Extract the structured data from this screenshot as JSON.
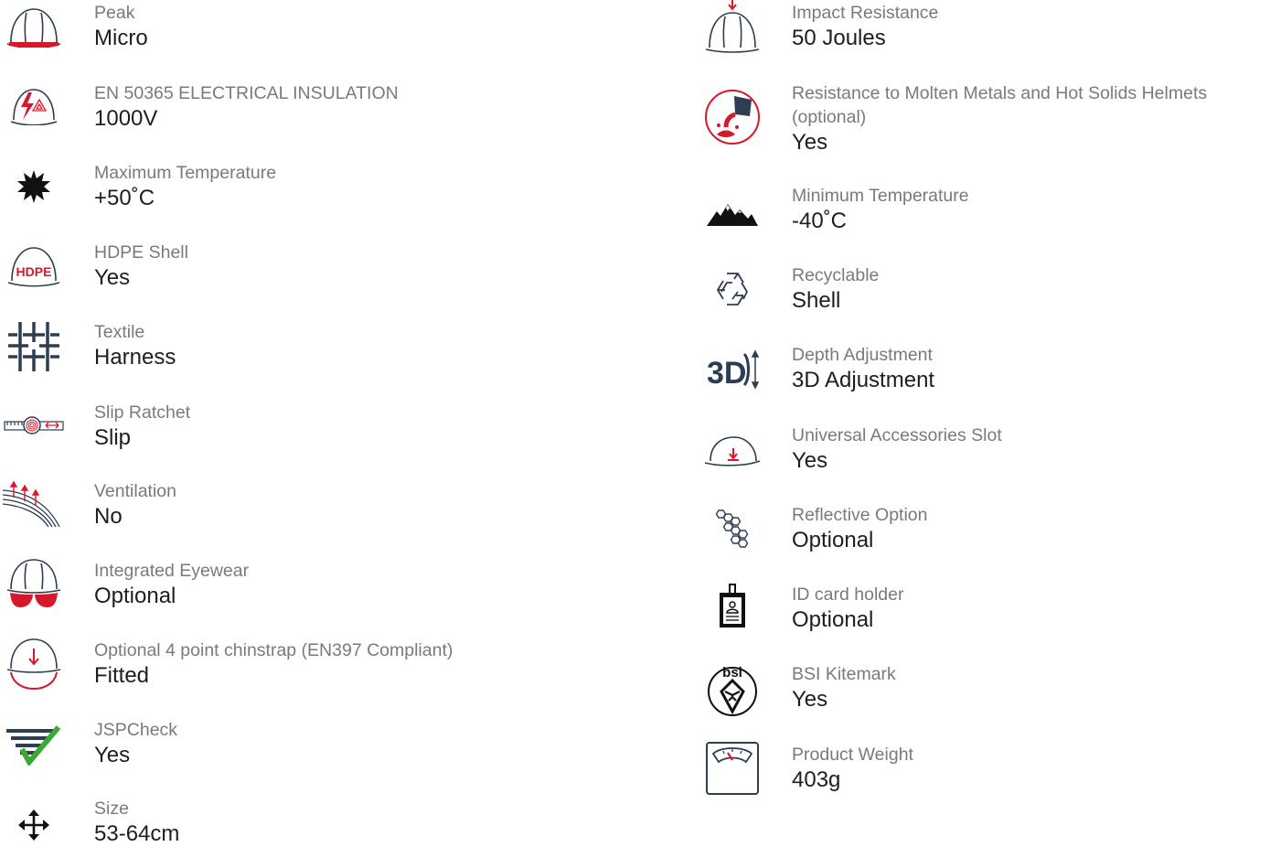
{
  "features_left": [
    {
      "label": "Peak",
      "value": "Micro",
      "icon": "helmet-peak-icon"
    },
    {
      "label": "EN 50365 ELECTRICAL INSULATION",
      "value": "1000V",
      "icon": "electrical-insulation-helmet-icon"
    },
    {
      "label": "Maximum Temperature",
      "value": "+50˚C",
      "icon": "sun-icon"
    },
    {
      "label": "HDPE Shell",
      "value": "Yes",
      "icon": "hdpe-helmet-icon"
    },
    {
      "label": "Textile",
      "value": "Harness",
      "icon": "textile-harness-icon"
    },
    {
      "label": "Slip Ratchet",
      "value": "Slip",
      "icon": "slip-ratchet-icon"
    },
    {
      "label": "Ventilation",
      "value": "No",
      "icon": "ventilation-icon"
    },
    {
      "label": "Integrated Eyewear",
      "value": "Optional",
      "icon": "helmet-eyewear-icon"
    },
    {
      "label": "Optional 4 point chinstrap (EN397 Compliant)",
      "value": "Fitted",
      "icon": "helmet-chinstrap-icon"
    },
    {
      "label": "JSPCheck",
      "value": "Yes",
      "icon": "jspcheck-icon"
    },
    {
      "label": "Size",
      "value": "53-64cm",
      "icon": "size-arrows-icon"
    }
  ],
  "features_right": [
    {
      "label": "Impact Resistance",
      "value": "50 Joules",
      "icon": "impact-helmet-icon"
    },
    {
      "label": "Resistance to Molten Metals and Hot Solids Helmets (optional)",
      "value": "Yes",
      "icon": "molten-metal-icon"
    },
    {
      "label": "Minimum Temperature",
      "value": "-40˚C",
      "icon": "mountains-icon"
    },
    {
      "label": "Recyclable",
      "value": "Shell",
      "icon": "recycle-icon"
    },
    {
      "label": "Depth Adjustment",
      "value": "3D Adjustment",
      "icon": "3d-adjustment-icon"
    },
    {
      "label": "Universal Accessories Slot",
      "value": "Yes",
      "icon": "accessory-slot-icon"
    },
    {
      "label": "Reflective Option",
      "value": "Optional",
      "icon": "hexagon-reflective-icon"
    },
    {
      "label": "ID card holder",
      "value": "Optional",
      "icon": "id-card-holder-icon"
    },
    {
      "label": "BSI Kitemark",
      "value": "Yes",
      "icon": "bsi-kitemark-icon",
      "logo_text": "bsi"
    },
    {
      "label": "Product Weight",
      "value": "403g",
      "icon": "weighing-scale-icon"
    }
  ],
  "colors": {
    "label": "#7a7a7a",
    "value": "#1e1e1e",
    "navy": "#2d3d52",
    "red": "#d9172b",
    "green": "#3aaa35"
  }
}
